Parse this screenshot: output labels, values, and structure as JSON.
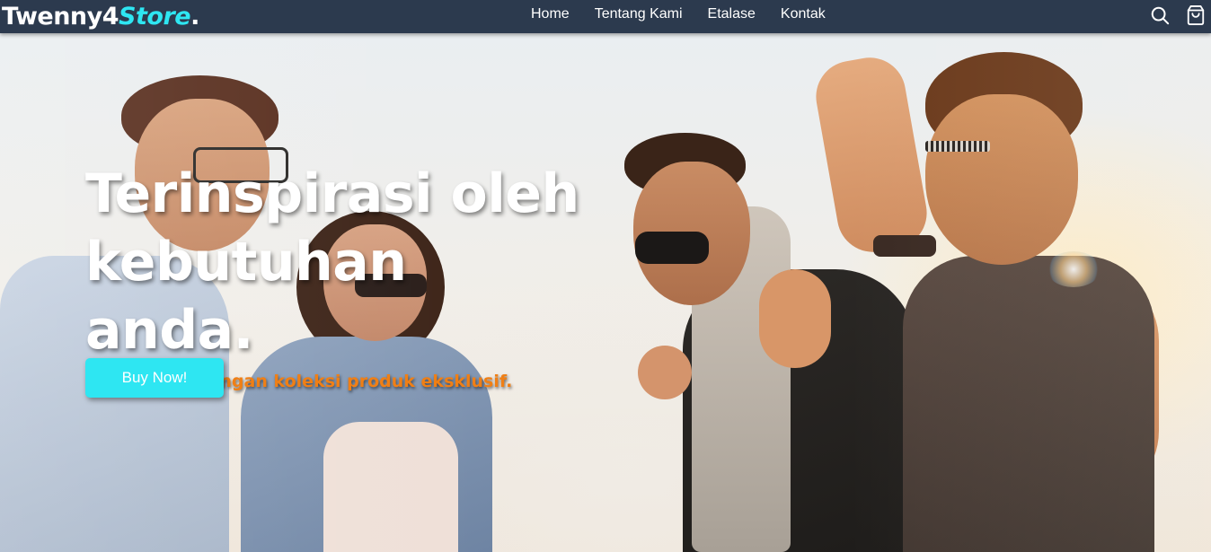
{
  "navbar": {
    "brand_main": "Twenny4",
    "brand_accent": "Store",
    "brand_dot": ".",
    "links": [
      "Home",
      "Tentang Kami",
      "Etalase",
      "Kontak"
    ],
    "icons": [
      "search-icon",
      "shopping-bag-icon"
    ]
  },
  "hero": {
    "title_line1": "Terinspirasi oleh",
    "title_line2": "kebutuhan anda.",
    "subtitle": "Kami hadir dengan koleksi produk eksklusif.",
    "button_label": "Buy Now!"
  },
  "colors": {
    "navbar_bg": "#2c3a4e",
    "accent_cyan": "#2ee6f2",
    "subtitle_orange": "#f07f15",
    "text_white": "#ffffff"
  }
}
